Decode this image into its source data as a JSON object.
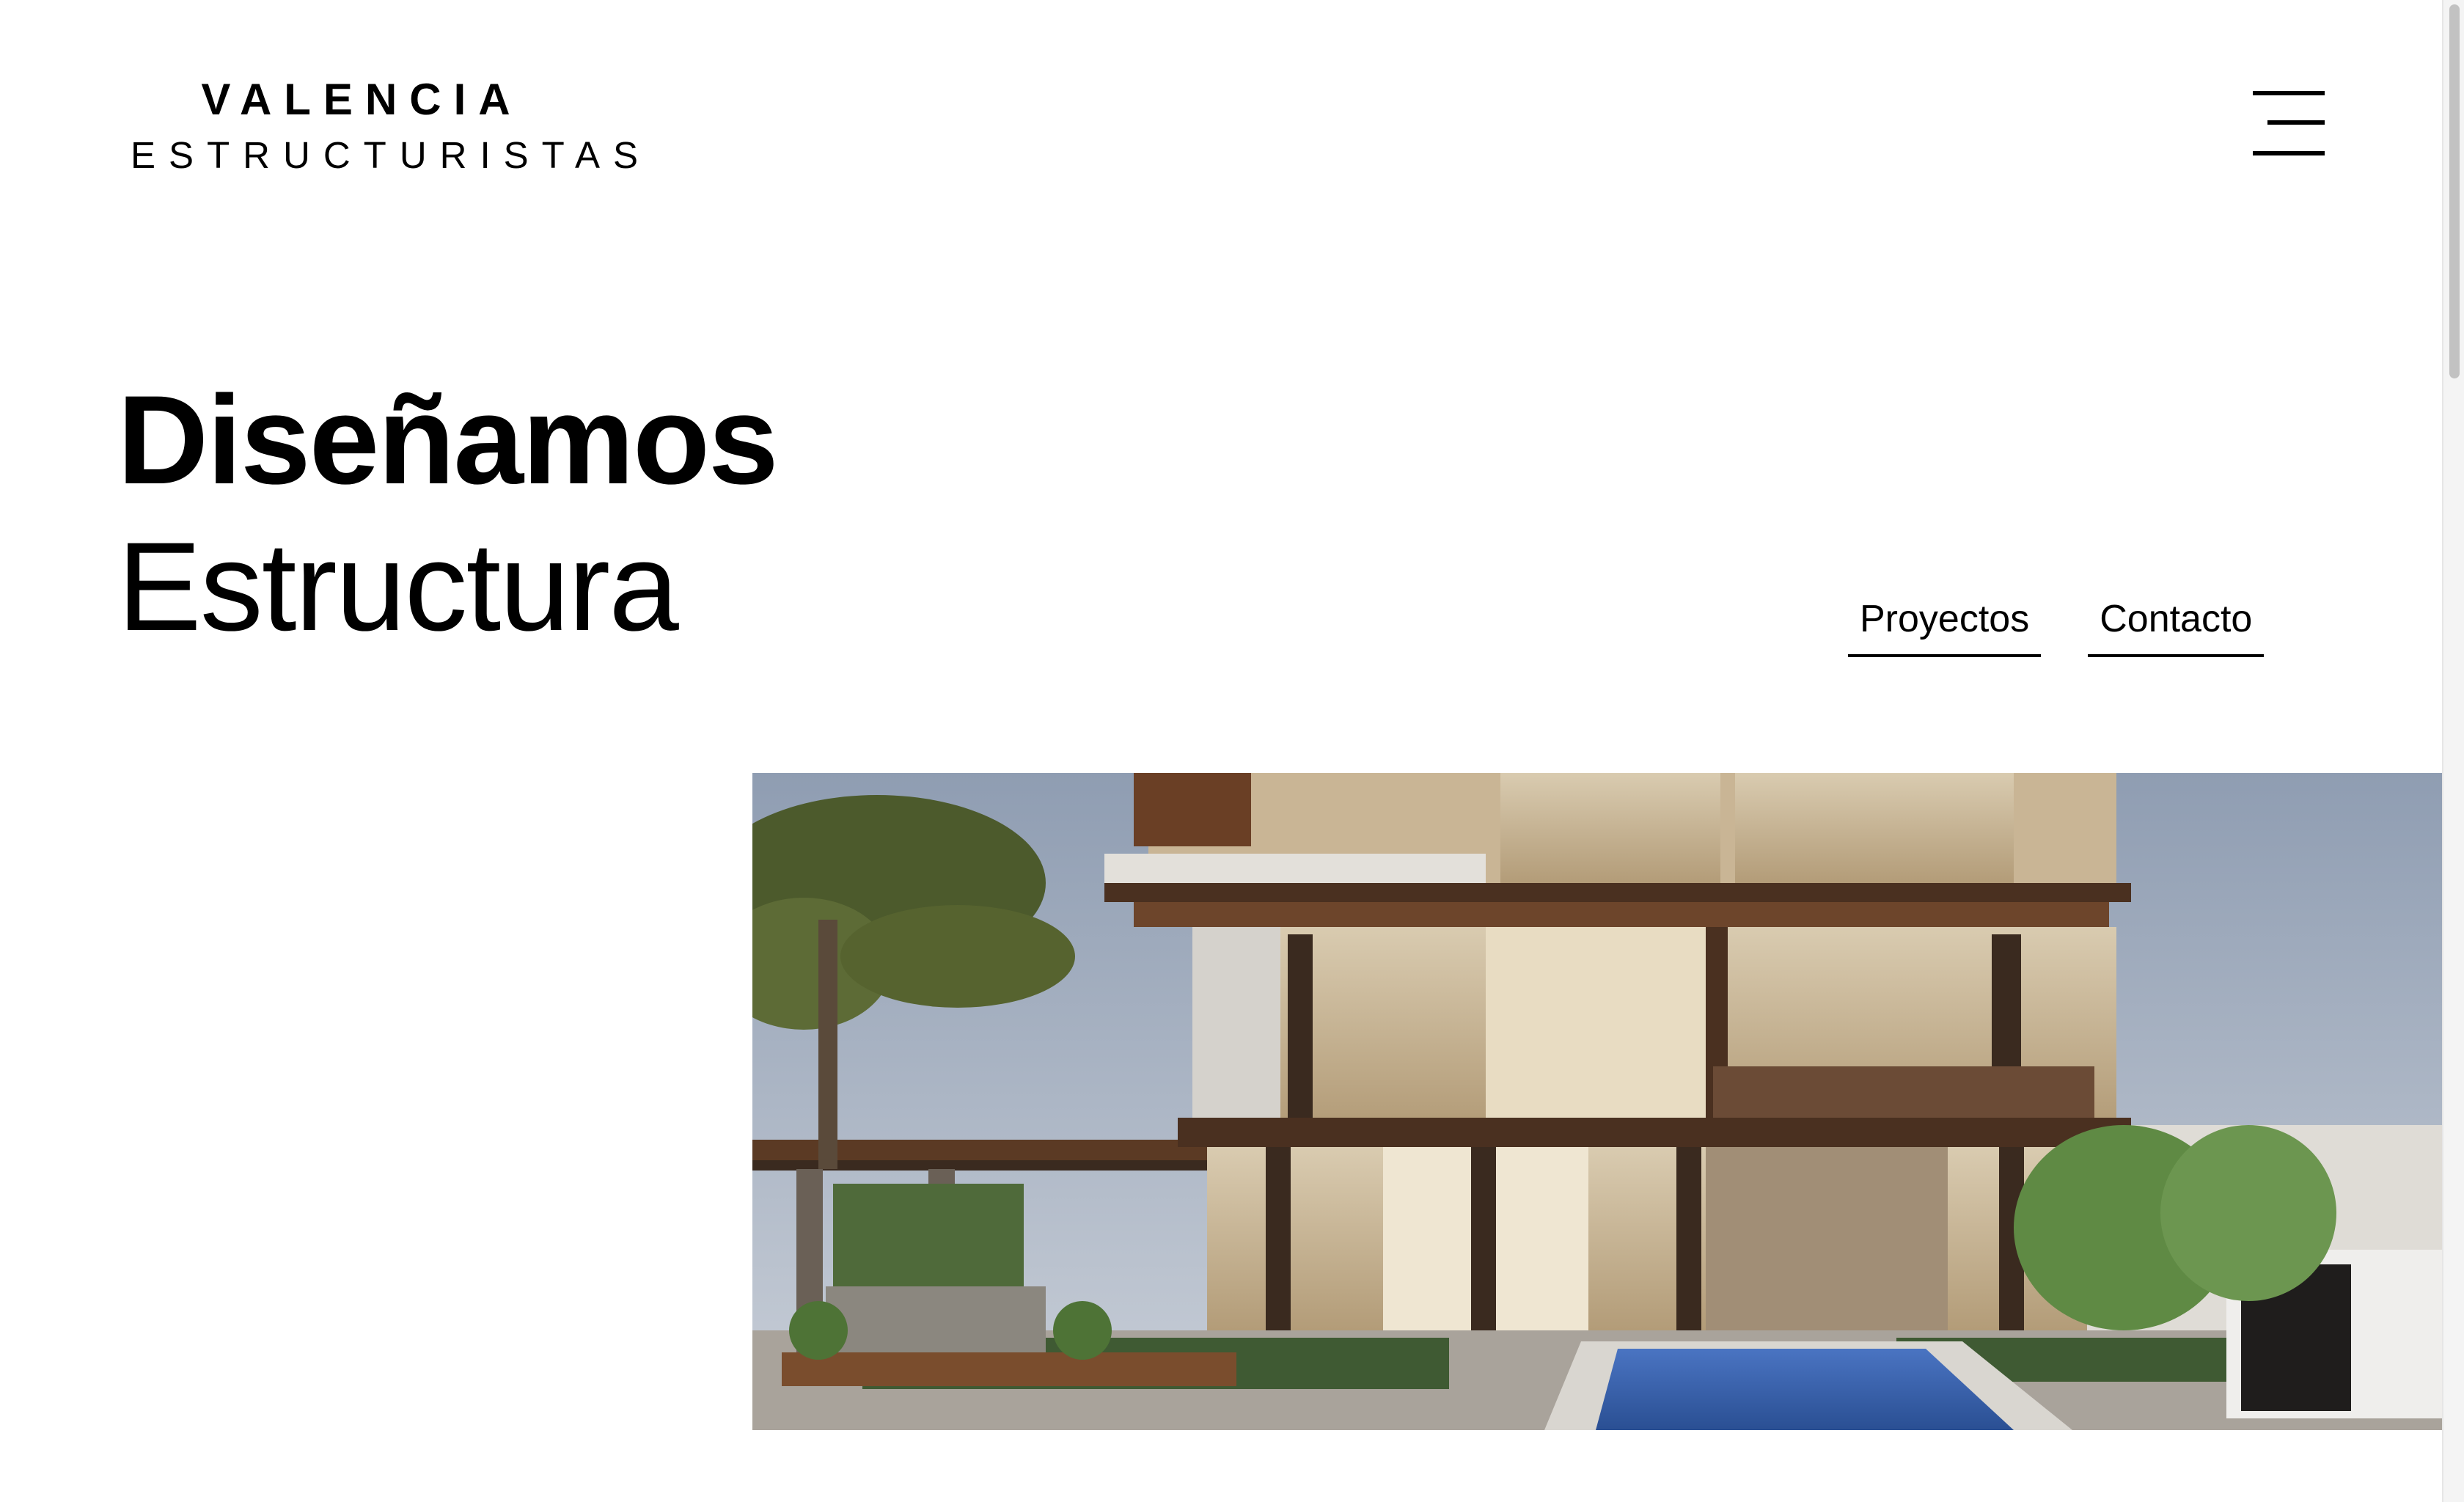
{
  "header": {
    "logo_line1": "VALENCIA",
    "logo_line2": "ESTRUCTURISTAS",
    "menu_icon": "hamburger-menu-icon"
  },
  "hero": {
    "title_bold": "Diseñamos",
    "title_light": "Estructura",
    "nav": [
      {
        "label": "Proyectos"
      },
      {
        "label": "Contacto"
      }
    ],
    "image_alt": "Render de edificio residencial moderno con piscina y palmera"
  },
  "colors": {
    "text": "#000000",
    "background": "#ffffff",
    "sky": "#9ba8bb",
    "wood": "#5a3a26",
    "pool": "#2f5aa6"
  }
}
